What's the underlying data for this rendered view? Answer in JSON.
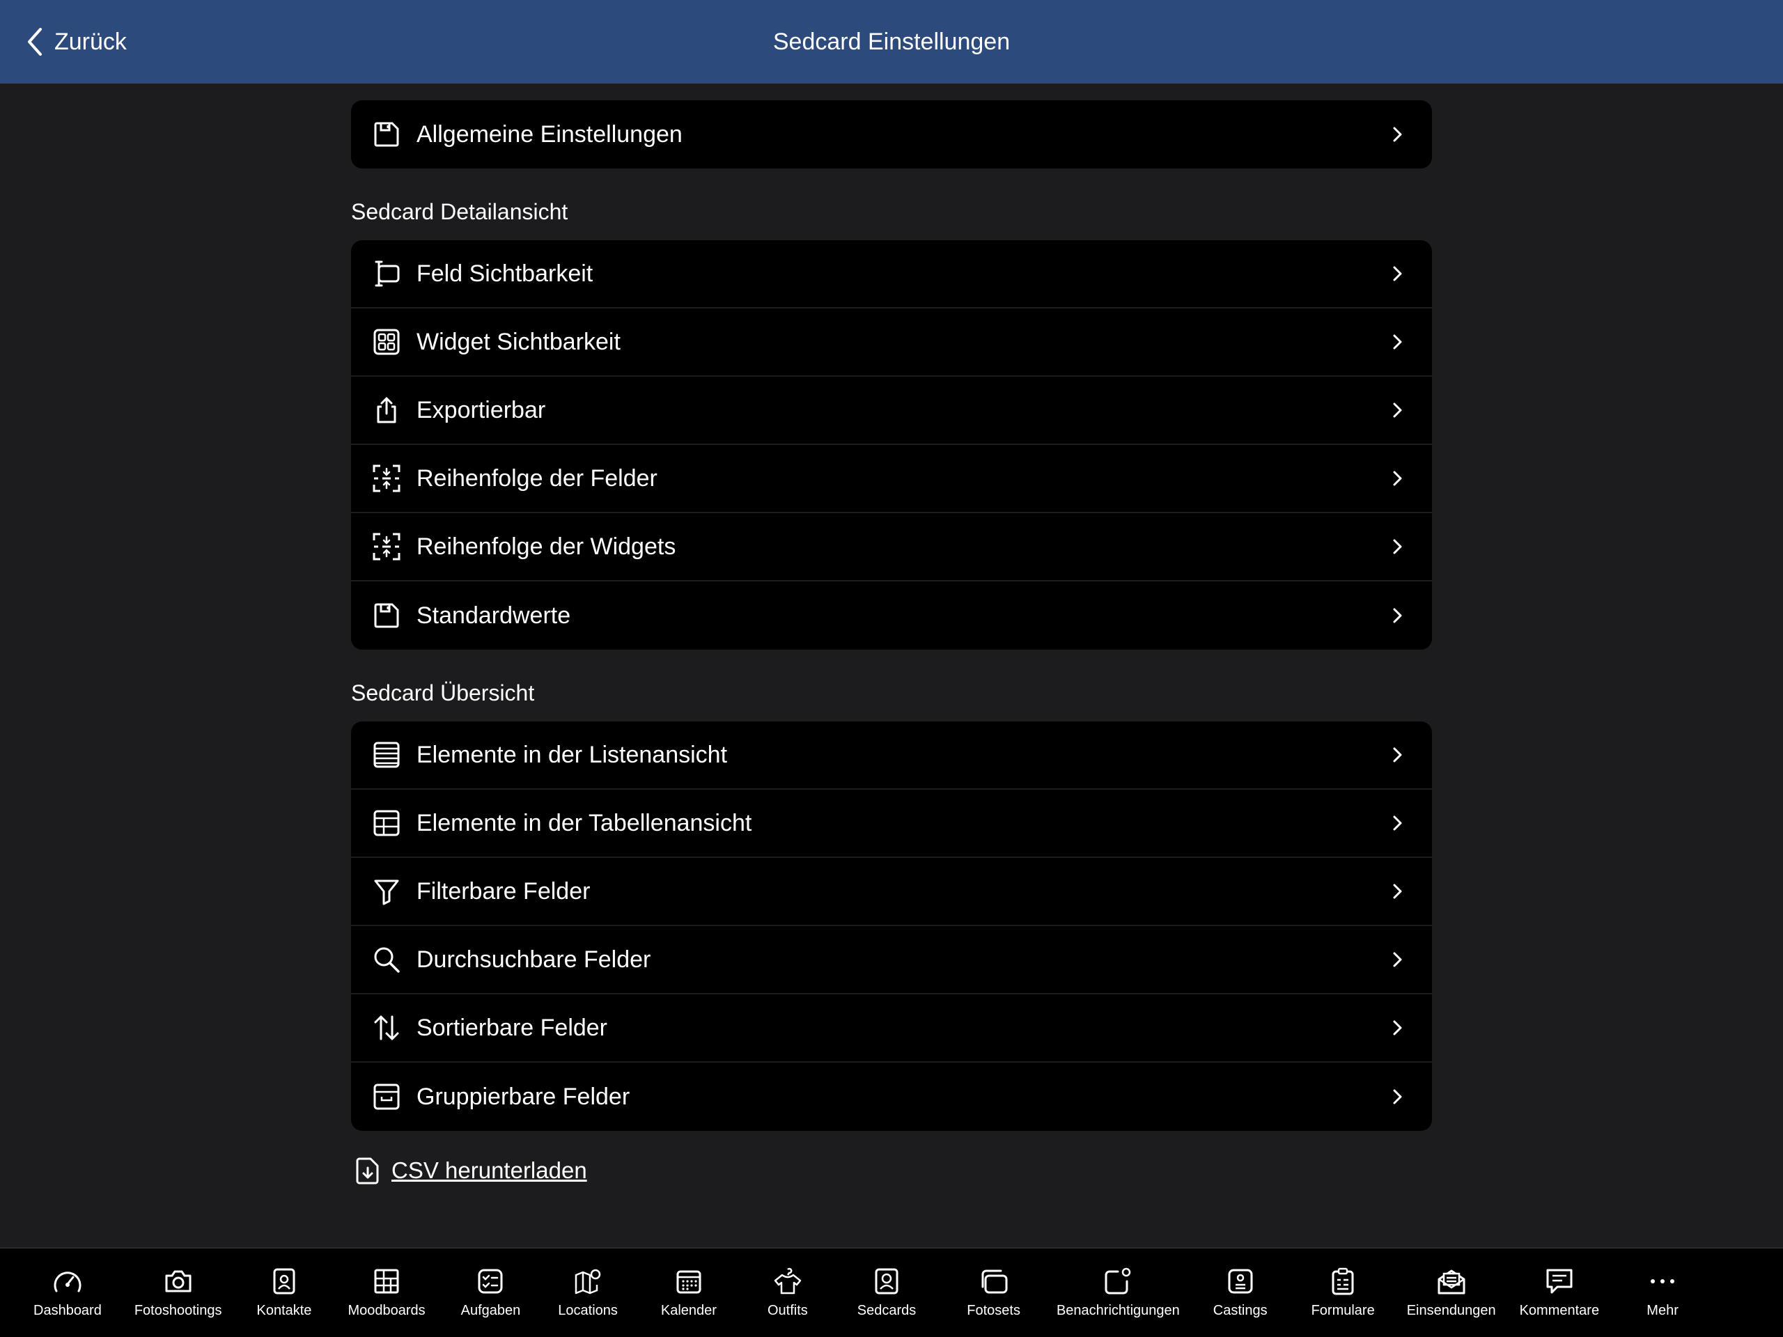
{
  "header": {
    "back_label": "Zurück",
    "title": "Sedcard Einstellungen"
  },
  "general": {
    "items": [
      {
        "label": "Allgemeine Einstellungen",
        "icon": "save-icon"
      }
    ]
  },
  "detail_section": {
    "title": "Sedcard Detailansicht",
    "items": [
      {
        "label": "Feld Sichtbarkeit",
        "icon": "text-cursor-field-icon"
      },
      {
        "label": "Widget Sichtbarkeit",
        "icon": "widgets-grid-icon"
      },
      {
        "label": "Exportierbar",
        "icon": "share-export-icon"
      },
      {
        "label": "Reihenfolge der Felder",
        "icon": "reorder-icon"
      },
      {
        "label": "Reihenfolge der Widgets",
        "icon": "reorder-icon"
      },
      {
        "label": "Standardwerte",
        "icon": "save-icon"
      }
    ]
  },
  "overview_section": {
    "title": "Sedcard Übersicht",
    "items": [
      {
        "label": "Elemente in der Listenansicht",
        "icon": "list-view-icon"
      },
      {
        "label": "Elemente in der Tabellenansicht",
        "icon": "table-view-icon"
      },
      {
        "label": "Filterbare Felder",
        "icon": "filter-icon"
      },
      {
        "label": "Durchsuchbare Felder",
        "icon": "search-icon"
      },
      {
        "label": "Sortierbare Felder",
        "icon": "sort-arrows-icon"
      },
      {
        "label": "Gruppierbare Felder",
        "icon": "archive-box-icon"
      }
    ]
  },
  "csv": {
    "label": "CSV herunterladen",
    "icon": "file-download-icon"
  },
  "tabbar": {
    "items": [
      {
        "label": "Dashboard",
        "icon": "dashboard-gauge-icon"
      },
      {
        "label": "Fotoshootings",
        "icon": "camera-icon"
      },
      {
        "label": "Kontakte",
        "icon": "contact-badge-icon"
      },
      {
        "label": "Moodboards",
        "icon": "moodboard-icon"
      },
      {
        "label": "Aufgaben",
        "icon": "task-checklist-icon"
      },
      {
        "label": "Locations",
        "icon": "map-pin-icon"
      },
      {
        "label": "Kalender",
        "icon": "calendar-icon"
      },
      {
        "label": "Outfits",
        "icon": "shirt-icon"
      },
      {
        "label": "Sedcards",
        "icon": "sedcard-portrait-icon"
      },
      {
        "label": "Fotosets",
        "icon": "photo-stack-icon"
      },
      {
        "label": "Benachrichtigungen",
        "icon": "notification-badge-icon"
      },
      {
        "label": "Castings",
        "icon": "casting-card-icon"
      },
      {
        "label": "Formulare",
        "icon": "clipboard-form-icon"
      },
      {
        "label": "Einsendungen",
        "icon": "mail-open-icon"
      },
      {
        "label": "Kommentare",
        "icon": "comment-icon"
      },
      {
        "label": "Mehr",
        "icon": "more-dots-icon"
      }
    ]
  },
  "colors": {
    "header_bg": "#2d4a7d",
    "page_bg": "#1c1c1e",
    "card_bg": "#000000",
    "text": "#ffffff"
  }
}
